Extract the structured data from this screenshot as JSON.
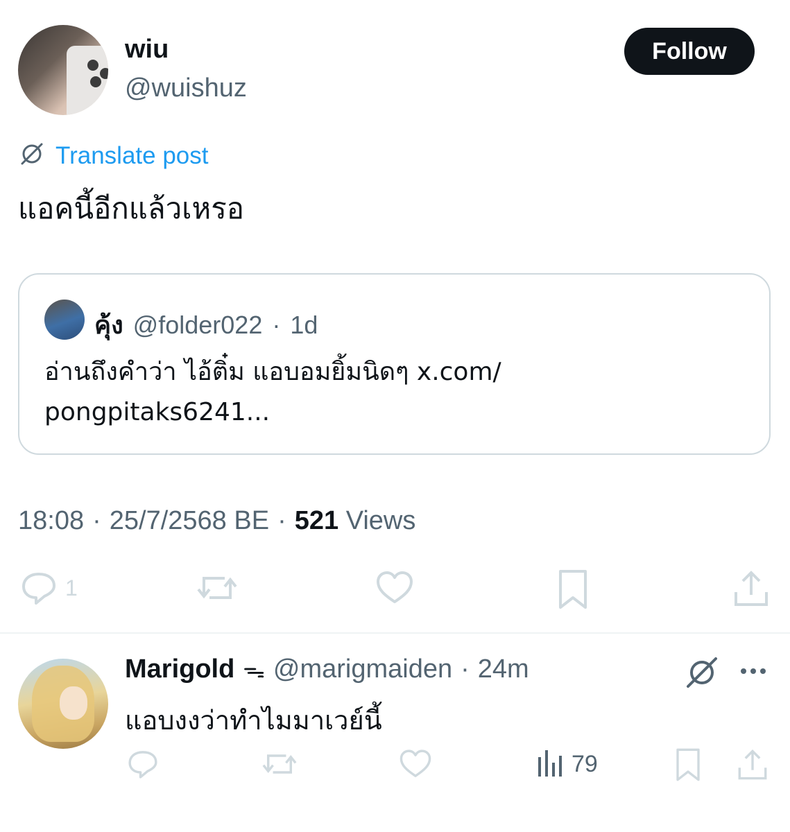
{
  "post": {
    "display_name": "wiu",
    "handle": "@wuishuz",
    "follow_label": "Follow",
    "translate_label": "Translate post",
    "text": "แอคนี้อีกแล้วเหรอ",
    "time": "18:08",
    "date": "25/7/2568 BE",
    "views_count": "521",
    "views_label": "Views",
    "reply_count": "1",
    "icons": [
      "translate-icon",
      "reply-icon",
      "repost-icon",
      "like-icon",
      "bookmark-icon",
      "share-icon"
    ]
  },
  "quote": {
    "display_name": "คุ้ง",
    "handle": "@folder022",
    "dot": "·",
    "time": "1d",
    "text_line1": "อ่านถึงคำว่า ไอ้ติ๋ม แอบอมยิ้มนิดๆ x.com/",
    "text_line2": "pongpitaks6241..."
  },
  "reply": {
    "display_name": "Marigold",
    "badge": "ᯓ",
    "handle": "@marigmaiden",
    "dot": "·",
    "time": "24m",
    "text": "แอบงงว่าทำไมมาเวย์นี้",
    "views": "79",
    "icons": [
      "translate-icon",
      "more-icon",
      "reply-icon",
      "repost-icon",
      "like-icon",
      "views-icon",
      "bookmark-icon",
      "share-icon"
    ]
  },
  "colors": {
    "text": "#0f1419",
    "secondary": "#536471",
    "link": "#1d9bf0",
    "border": "#cfd9de",
    "icon_light": "#cfd9de"
  }
}
